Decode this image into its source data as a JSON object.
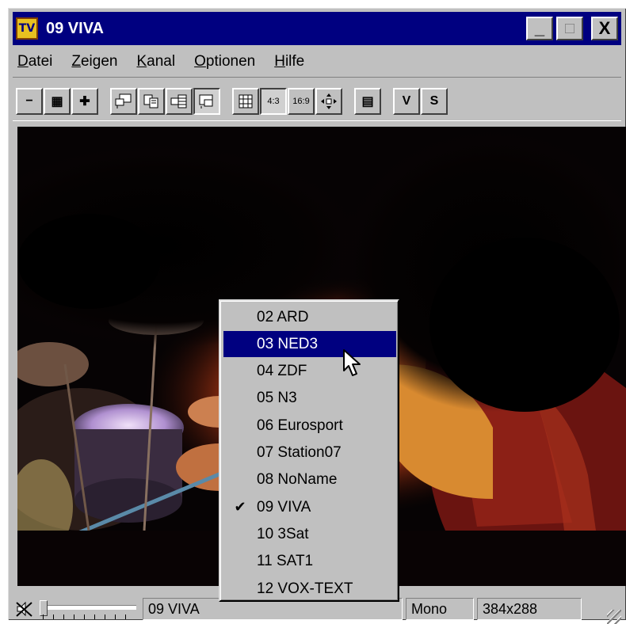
{
  "window": {
    "title": "09 VIVA",
    "icon": "tv-icon",
    "icon_text": "TV"
  },
  "title_buttons": {
    "minimize": "_",
    "maximize": "□",
    "close": "X"
  },
  "menu": [
    {
      "accel": "D",
      "rest": "atei"
    },
    {
      "accel": "Z",
      "rest": "eigen"
    },
    {
      "accel": "K",
      "rest": "anal"
    },
    {
      "accel": "O",
      "rest": "ptionen"
    },
    {
      "accel": "H",
      "rest": "ilfe"
    }
  ],
  "toolbar": {
    "volume_down": "−",
    "color": "▦",
    "volume_up": "✚",
    "aspect_43": "4:3",
    "aspect_169": "16:9",
    "teletext": "▤",
    "video_label": "V",
    "sound_label": "S"
  },
  "channel_menu": {
    "items": [
      {
        "label": "02 ARD",
        "checked": false,
        "highlighted": false
      },
      {
        "label": "03 NED3",
        "checked": false,
        "highlighted": true
      },
      {
        "label": "04 ZDF",
        "checked": false,
        "highlighted": false
      },
      {
        "label": "05 N3",
        "checked": false,
        "highlighted": false
      },
      {
        "label": "06 Eurosport",
        "checked": false,
        "highlighted": false
      },
      {
        "label": "07 Station07",
        "checked": false,
        "highlighted": false
      },
      {
        "label": "08 NoName",
        "checked": false,
        "highlighted": false
      },
      {
        "label": "09 VIVA",
        "checked": true,
        "highlighted": false
      },
      {
        "label": "10 3Sat",
        "checked": false,
        "highlighted": false
      },
      {
        "label": "11 SAT1",
        "checked": false,
        "highlighted": false
      },
      {
        "label": "12 VOX-TEXT",
        "checked": false,
        "highlighted": false
      }
    ],
    "check_glyph": "✔"
  },
  "status": {
    "mute_glyph": "🕨",
    "volume_level": 0.0,
    "channel": "09 VIVA",
    "audio": "Mono",
    "resolution": "384x288"
  }
}
